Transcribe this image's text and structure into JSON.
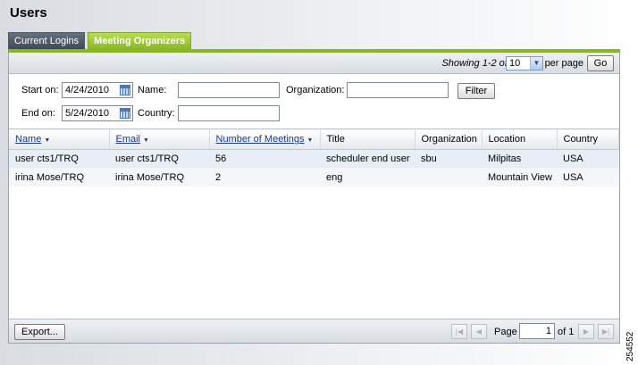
{
  "page": {
    "title": "Users",
    "figure_number": "254552"
  },
  "tabs": [
    {
      "label": "Current Logins",
      "active": false
    },
    {
      "label": "Meeting Organizers",
      "active": true
    }
  ],
  "toolbar": {
    "showing": "Showing 1-2 of 2",
    "per_page_value": "10",
    "per_page_label": "per page",
    "go_label": "Go"
  },
  "filters": {
    "start_label": "Start on:",
    "start_value": "4/24/2010",
    "end_label": "End on:",
    "end_value": "5/24/2010",
    "name_label": "Name:",
    "name_value": "",
    "country_label": "Country:",
    "country_value": "",
    "org_label": "Organization:",
    "org_value": "",
    "filter_button": "Filter"
  },
  "table": {
    "columns": [
      "Name",
      "Email",
      "Number of Meetings",
      "Title",
      "Organization",
      "Location",
      "Country"
    ],
    "rows": [
      [
        "user cts1/TRQ",
        "user cts1/TRQ",
        "56",
        "scheduler end user",
        "sbu",
        "Milpitas",
        "USA"
      ],
      [
        "irina Mose/TRQ",
        "irina Mose/TRQ",
        "2",
        "eng",
        "",
        "Mountain View",
        "USA"
      ]
    ]
  },
  "footer": {
    "export_label": "Export...",
    "page_label": "Page",
    "page_value": "1",
    "of_label": "of 1"
  },
  "colors": {
    "accent": "#88b524",
    "tab_inactive": "#4c5866",
    "row_alt": "#e8eef6"
  }
}
